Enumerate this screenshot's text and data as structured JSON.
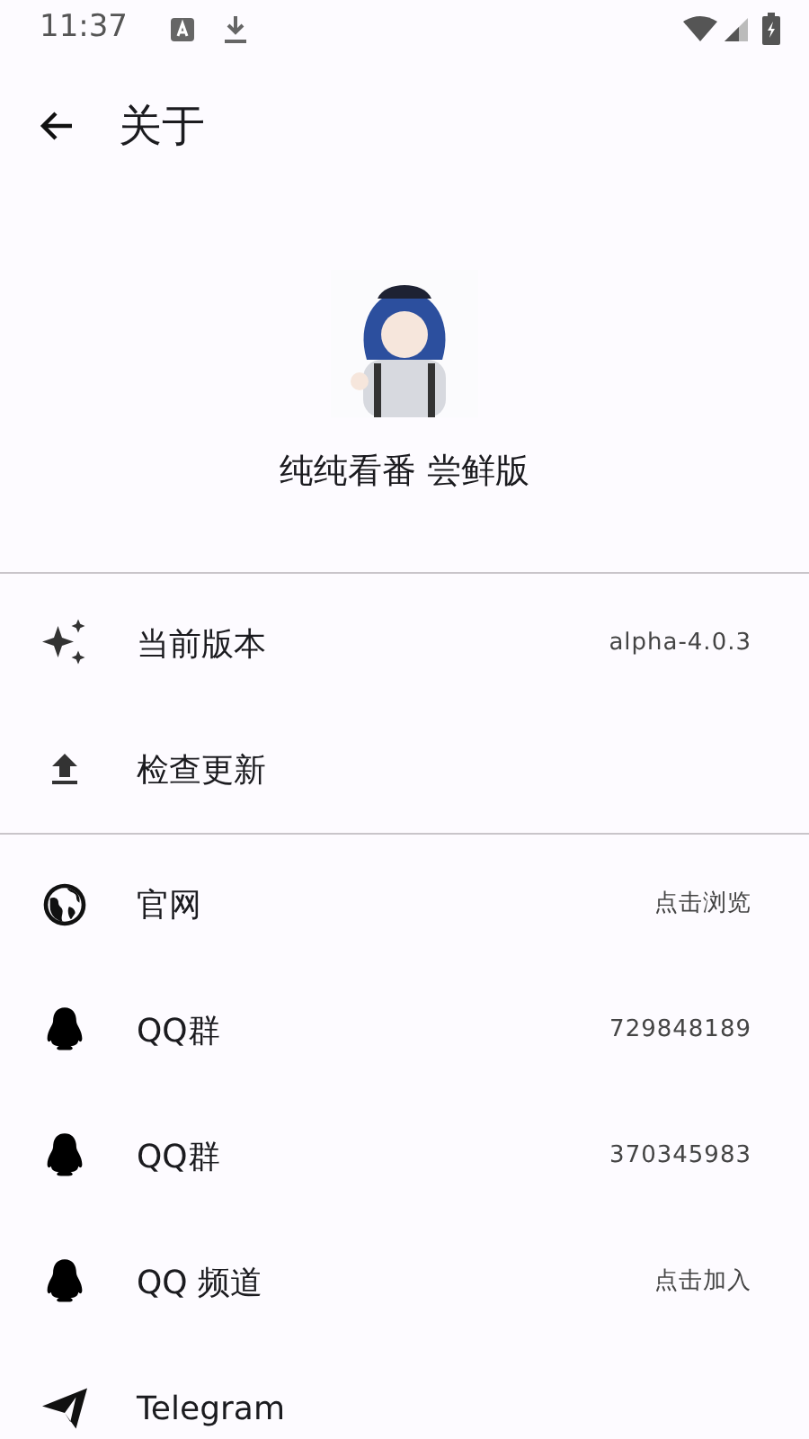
{
  "status_bar": {
    "time": "11:37"
  },
  "toolbar": {
    "title": "关于"
  },
  "app": {
    "name": "纯纯看番 尝鲜版"
  },
  "sections": [
    [
      {
        "label": "当前版本",
        "value": "alpha-4.0.3"
      },
      {
        "label": "检查更新"
      }
    ],
    [
      {
        "label": "官网",
        "value": "点击浏览"
      },
      {
        "label": "QQ群",
        "value": "729848189"
      },
      {
        "label": "QQ群",
        "value": "370345983"
      },
      {
        "label": "QQ 频道",
        "value": "点击加入"
      },
      {
        "label": "Telegram"
      }
    ]
  ]
}
